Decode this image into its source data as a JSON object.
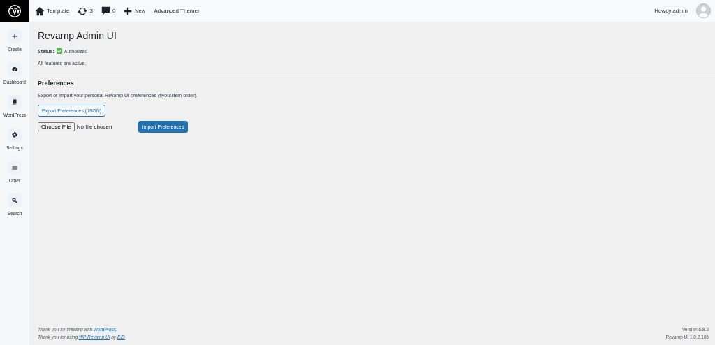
{
  "topbar": {
    "items": [
      {
        "kind": "site",
        "label": "Template"
      },
      {
        "kind": "updates",
        "label": "3"
      },
      {
        "kind": "comments",
        "label": "0"
      },
      {
        "kind": "new",
        "label": "New"
      },
      {
        "kind": "text",
        "label": "Advanced Themer"
      }
    ],
    "greeting": "Howdy,admin"
  },
  "sidebar": {
    "items": [
      {
        "kind": "plus",
        "label": "Create"
      },
      {
        "kind": "gauge",
        "label": "Dashboard"
      },
      {
        "kind": "pages",
        "label": "WordPress"
      },
      {
        "kind": "gear",
        "label": "Settings"
      },
      {
        "kind": "lines",
        "label": "Other"
      },
      {
        "kind": "search",
        "label": "Search"
      }
    ]
  },
  "page": {
    "title": "Revamp Admin UI",
    "status_label": "Status:",
    "status": {
      "checked": true,
      "label": "Authorized"
    },
    "note": "All features are active."
  },
  "preferences": {
    "heading": "Preferences",
    "description": "Export or import your personal Revamp UI preferences (flyout item order).",
    "export_button": "Export Preferences (JSON)",
    "file_button": "Choose File",
    "file_status": "No file chosen",
    "import_button": "Import Preferences"
  },
  "footer": {
    "left": [
      {
        "parts": [
          {
            "kind": "text",
            "text": "Thank you for creating with "
          },
          {
            "kind": "link",
            "text": "WordPress"
          },
          {
            "kind": "text",
            "text": "."
          }
        ]
      },
      {
        "parts": [
          {
            "kind": "text",
            "text": "Thank you for using "
          },
          {
            "kind": "link",
            "text": "WP Revamp UI"
          },
          {
            "kind": "text",
            "text": " by "
          },
          {
            "kind": "link",
            "text": "EID"
          }
        ]
      }
    ],
    "right": [
      "Version 6.8.2",
      "Revamp UI 1.0.2.105"
    ]
  }
}
